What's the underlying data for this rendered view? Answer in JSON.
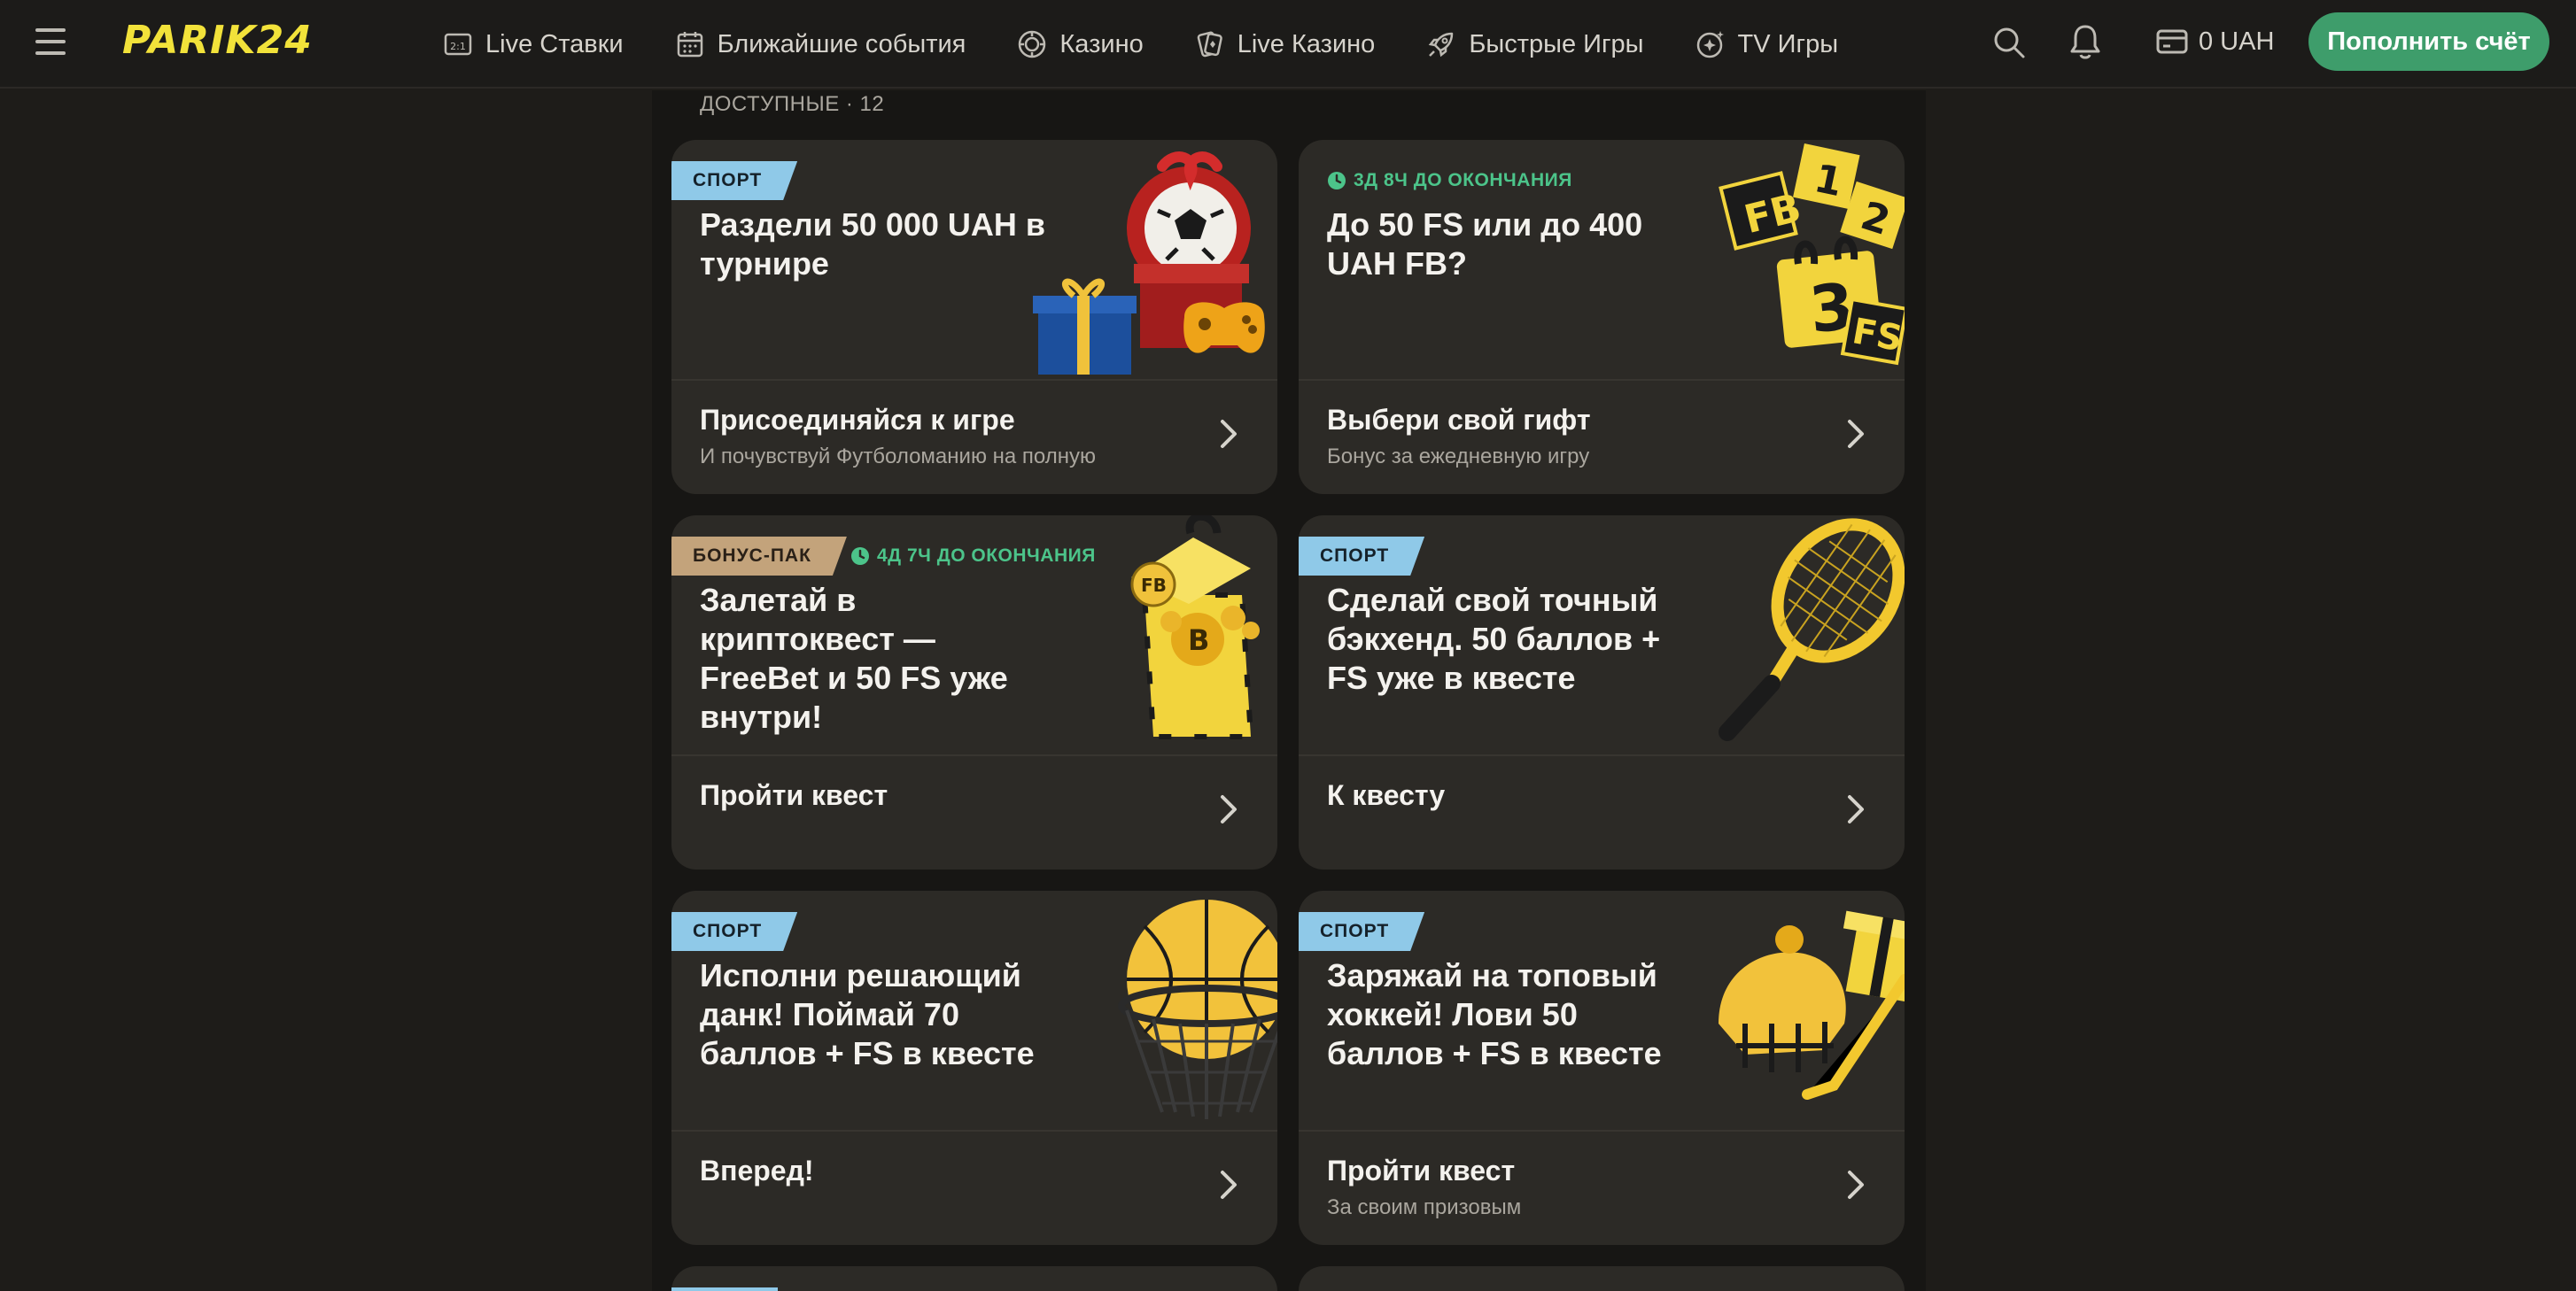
{
  "header": {
    "logo": "PARIK24",
    "nav": [
      {
        "label": "Live Ставки",
        "icon": "live-bets-icon"
      },
      {
        "label": "Ближайшие события",
        "icon": "calendar-icon"
      },
      {
        "label": "Казино",
        "icon": "casino-chip-icon"
      },
      {
        "label": "Live Казино",
        "icon": "playing-card-icon"
      },
      {
        "label": "Быстрые Игры",
        "icon": "rocket-icon"
      },
      {
        "label": "TV Игры",
        "icon": "tv-sparkle-icon"
      }
    ],
    "balance": "0 UAH",
    "deposit_label": "Пополнить счёт"
  },
  "section_label": "ДОСТУПНЫЕ · 12",
  "cards": [
    {
      "badge": "СПОРТ",
      "title": "Раздели 50 000 UAH в турнире",
      "cta": "Присоединяйся к игре",
      "sub": "И почувствуй Футболоманию на полную",
      "art": "football-gift-art"
    },
    {
      "timer": "3Д 8Ч ДО ОКОНЧАНИЯ",
      "title": "До 50 FS или до 400 UAH FB?",
      "cta": "Выбери свой гифт",
      "sub": "Бонус за ежедневную игру",
      "art": "calendar-numbers-art"
    },
    {
      "badge": "БОНУС-ПАК",
      "timer": "4Д 7Ч ДО ОКОНЧАНИЯ",
      "title": "Залетай в криптоквест — FreeBet и 50 FS уже внутри!",
      "cta": "Пройти квест",
      "sub": "",
      "art": "crypto-box-art"
    },
    {
      "badge": "СПОРТ",
      "title": "Сделай свой точный бэкхенд. 50 баллов + FS уже в квесте",
      "cta": "К квесту",
      "sub": "",
      "art": "tennis-racket-art"
    },
    {
      "badge": "СПОРТ",
      "title": "Исполни решающий данк! Поймай 70 баллов + FS в квесте",
      "cta": "Вперед!",
      "sub": "",
      "art": "basketball-art"
    },
    {
      "badge": "СПОРТ",
      "title": "Заряжай на топовый хоккей! Лови 50 баллов + FS в квесте",
      "cta": "Пройти квест",
      "sub": "За своим призовым",
      "art": "hockey-art"
    }
  ],
  "colors": {
    "accent": "#3e9d6b",
    "logo": "#f2e23a",
    "sport_badge": "#8fc9e8",
    "bonus_badge": "#c3a37b",
    "timer": "#4cc48a"
  }
}
